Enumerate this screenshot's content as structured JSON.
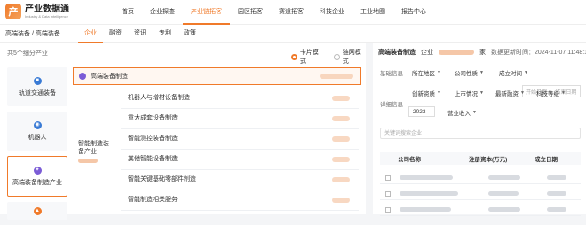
{
  "brand": {
    "logo_char": "产",
    "name": "产业数据通",
    "subtitle": "Industry & Data Intelligence"
  },
  "nav": {
    "items": [
      "首页",
      "企业探查",
      "产业链拓客",
      "园区拓客",
      "赛道拓客",
      "科技企业",
      "工业地图",
      "报告中心"
    ],
    "active_index": 2
  },
  "subbar": {
    "breadcrumb": "高端装备 / 高端装备...",
    "tabs": [
      "企业",
      "融资",
      "资讯",
      "专利",
      "政策"
    ],
    "active_tab": 0
  },
  "left_panel": {
    "count_text": "共5个细分产业",
    "modes": [
      {
        "label": "卡片模式",
        "checked": true
      },
      {
        "label": "链网模式",
        "checked": false
      }
    ],
    "categories": [
      {
        "label": "轨道交通装备",
        "icon": "train-icon"
      },
      {
        "label": "机器人",
        "icon": "robot-icon"
      },
      {
        "label": "高端装备制造产业",
        "icon": "gear-icon",
        "active": true
      }
    ],
    "selected_header": "高端装备制造",
    "group_label": "智能制造装备产业",
    "sub_items": [
      "机器人与增材设备制造",
      "重大成套设备制造",
      "智能测控装备制造",
      "其他智能设备制造",
      "智能关键基础零部件制造",
      "智能制造相关服务"
    ]
  },
  "right_panel": {
    "title": "高端装备制造",
    "company_label": "企业",
    "company_unit": "家",
    "updated": "数据更新时间：2024-11-07 11:48:17",
    "basic_label": "基础信息",
    "basic_filters": [
      "所在地区",
      "公司性质",
      "成立时间"
    ],
    "date_placeholder": "开始日期  →  结束日期",
    "feature_filters": [
      "创新资质",
      "上市情况",
      "最新融资",
      "科技等级"
    ],
    "detail_label": "详细信息",
    "year": "2023",
    "revenue_filter": "营业收入",
    "search_placeholder": "关键词搜索企业",
    "table_headers": [
      "公司名称",
      "注册资本(万元)",
      "成立日期"
    ],
    "accent_color": "#f07a2a"
  }
}
